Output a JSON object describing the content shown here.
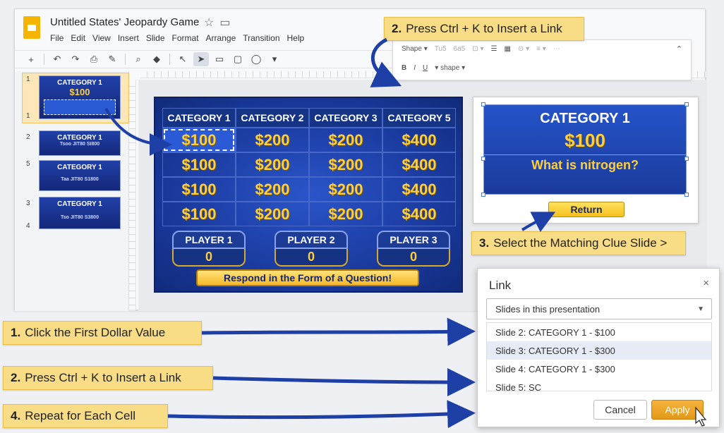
{
  "app": {
    "doc_title": "Untitled States' Jeopardy Game",
    "menu": [
      "File",
      "Edit",
      "View",
      "Insert",
      "Slide",
      "Format",
      "Arrange",
      "Transition",
      "Help"
    ]
  },
  "format_bar": {
    "shape_label": "Shape",
    "shape_small": "shape",
    "bold": "B",
    "italic": "I",
    "underline": "U"
  },
  "thumbnails": [
    {
      "num": "1",
      "num2": "1",
      "category": "CATEGORY 1",
      "value": "$100",
      "sub": ""
    },
    {
      "num": "2",
      "category": "CATEGORY 1",
      "value": "",
      "sub": "Tsoo JIT80 SI800"
    },
    {
      "num": "5",
      "category": "CATEGORY 1",
      "value": "",
      "sub": "Taa JIT80 S1800"
    },
    {
      "num": "3",
      "num2": "4",
      "category": "CATEGORY 1",
      "value": "",
      "sub": "Tso JIT80 S3800"
    }
  ],
  "board": {
    "headers": [
      "CATEGORY 1",
      "CATEGORY 2",
      "CATEGORY 3",
      "CATEGORY 5"
    ],
    "rows": [
      [
        "$100",
        "$200",
        "$200",
        "$400"
      ],
      [
        "$100",
        "$200",
        "$200",
        "$400"
      ],
      [
        "$100",
        "$200",
        "$200",
        "$400"
      ],
      [
        "$100",
        "$200",
        "$200",
        "$400"
      ]
    ],
    "players": [
      {
        "name": "PLAYER 1",
        "score": "0"
      },
      {
        "name": "PLAYER 2",
        "score": "0"
      },
      {
        "name": "PLAYER 3",
        "score": "0"
      }
    ],
    "banner": "Respond in the Form of a Question!"
  },
  "clue": {
    "category": "CATEGORY 1",
    "value": "$100",
    "answer": "What is nitrogen?",
    "return_label": "Return"
  },
  "callouts": {
    "top_num": "2.",
    "top_text": "Press Ctrl + K to Insert a Link",
    "step3_num": "3.",
    "step3_text": "Select the Matching Clue Slide >",
    "step1_num": "1.",
    "step1_text": "Click the First Dollar Value",
    "step2_num": "2.",
    "step2_text": "Press Ctrl + K to Insert a Link",
    "step4_num": "4.",
    "step4_text": "Repeat for Each Cell"
  },
  "link_dialog": {
    "title": "Link",
    "close": "×",
    "select_value": "Slides in this presentation",
    "items": [
      "Slide 2: CATEGORY 1 - $100",
      "Slide 3: CATEGORY 1 - $300",
      "Slide 4: CATEGORY 1 - $300",
      "Slide 5: SC"
    ],
    "highlighted_index": 1,
    "cancel": "Cancel",
    "apply": "Apply"
  },
  "colors": {
    "board_blue": "#1a3a9e",
    "dollar_gold": "#ffcf3a",
    "callout_yellow": "#f8dc86",
    "arrow_blue": "#1d3fa6"
  }
}
